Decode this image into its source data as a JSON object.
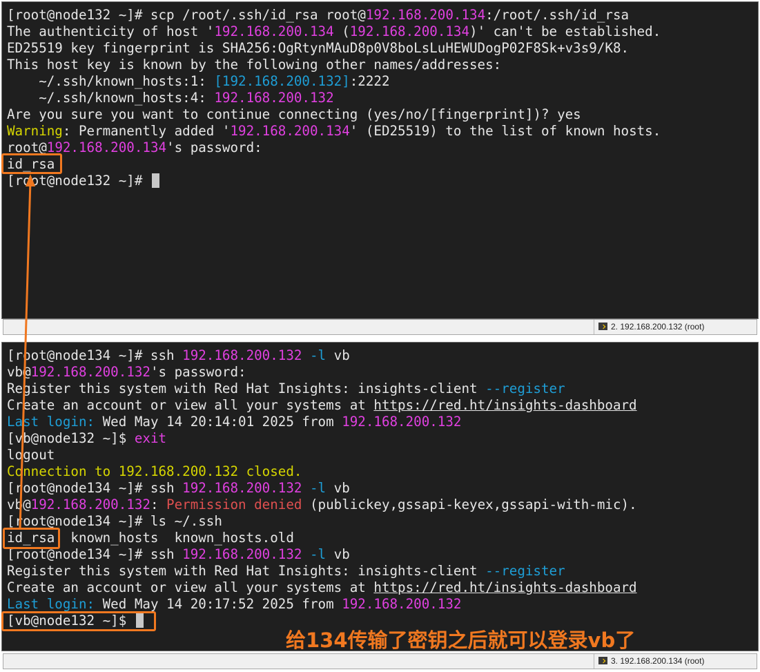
{
  "top_terminal": {
    "lines": [
      [
        {
          "t": "[root@node132 ~]# scp /root/.ssh/id_rsa root@"
        },
        {
          "t": "192.168.200.134",
          "k": "m"
        },
        {
          "t": ":/root/.ssh/id_rsa"
        }
      ],
      [
        {
          "t": "The authenticity of host '"
        },
        {
          "t": "192.168.200.134",
          "k": "m"
        },
        {
          "t": " ("
        },
        {
          "t": "192.168.200.134",
          "k": "m"
        },
        {
          "t": ")' can't be established."
        }
      ],
      [
        {
          "t": "ED25519 key fingerprint is SHA256:OgRtynMAuD8p0V8boLsLuHEWUDogP02F8Sk+v3s9/K8."
        }
      ],
      [
        {
          "t": "This host key is known by the following other names/addresses:"
        }
      ],
      [
        {
          "t": "    ~/.ssh/known_hosts:1: "
        },
        {
          "t": "[192.168.200.132]",
          "k": "c"
        },
        {
          "t": ":2222"
        }
      ],
      [
        {
          "t": "    ~/.ssh/known_hosts:4: "
        },
        {
          "t": "192.168.200.132",
          "k": "m"
        }
      ],
      [
        {
          "t": "Are you sure you want to continue connecting (yes/no/[fingerprint])? yes"
        }
      ],
      [
        {
          "t": "Warning",
          "k": "y"
        },
        {
          "t": ": Permanently added '"
        },
        {
          "t": "192.168.200.134",
          "k": "m"
        },
        {
          "t": "' (ED25519) to the list of known hosts."
        }
      ],
      [
        {
          "t": "root@"
        },
        {
          "t": "192.168.200.134",
          "k": "m"
        },
        {
          "t": "'s password:"
        }
      ],
      [
        {
          "t": "id_rsa"
        }
      ],
      [
        {
          "t": "[root@node132 ~]# "
        },
        {
          "cursor": true
        }
      ]
    ],
    "status_label": "2. 192.168.200.132 (root)"
  },
  "bottom_terminal": {
    "lines": [
      [
        {
          "t": "[root@node134 ~]# ssh "
        },
        {
          "t": "192.168.200.132",
          "k": "m"
        },
        {
          "t": " "
        },
        {
          "t": "-l",
          "k": "c"
        },
        {
          "t": " vb"
        }
      ],
      [
        {
          "t": "vb@"
        },
        {
          "t": "192.168.200.132",
          "k": "m"
        },
        {
          "t": "'s password:"
        }
      ],
      [
        {
          "t": "Register this system with Red Hat Insights: insights-client "
        },
        {
          "t": "--register",
          "k": "c"
        }
      ],
      [
        {
          "t": "Create an account or view all your systems at "
        },
        {
          "t": "https://red.ht/insights-dashboard",
          "k": "u"
        }
      ],
      [
        {
          "t": "Last login:",
          "k": "c"
        },
        {
          "t": " Wed May 14 20:14:01 2025 from "
        },
        {
          "t": "192.168.200.132",
          "k": "m"
        }
      ],
      [
        {
          "t": "[vb@node132 ~]$ "
        },
        {
          "t": "exit",
          "k": "m"
        }
      ],
      [
        {
          "t": "logout"
        }
      ],
      [
        {
          "t": "Connection to ",
          "k": "y"
        },
        {
          "t": "192.168.200.132",
          "k": "y"
        },
        {
          "t": " closed.",
          "k": "y"
        }
      ],
      [
        {
          "t": "[root@node134 ~]# ssh "
        },
        {
          "t": "192.168.200.132",
          "k": "m"
        },
        {
          "t": " "
        },
        {
          "t": "-l",
          "k": "c"
        },
        {
          "t": " vb"
        }
      ],
      [
        {
          "t": "vb@"
        },
        {
          "t": "192.168.200.132",
          "k": "m"
        },
        {
          "t": ": "
        },
        {
          "t": "Permission denied",
          "k": "r"
        },
        {
          "t": " (publickey,gssapi-keyex,gssapi-with-mic)."
        }
      ],
      [
        {
          "t": "[root@node134 ~]# ls ~/.ssh"
        }
      ],
      [
        {
          "t": "id_rsa  known_hosts  known_hosts.old"
        }
      ],
      [
        {
          "t": "[root@node134 ~]# ssh "
        },
        {
          "t": "192.168.200.132",
          "k": "m"
        },
        {
          "t": " "
        },
        {
          "t": "-l",
          "k": "c"
        },
        {
          "t": " vb"
        }
      ],
      [
        {
          "t": "Register this system with Red Hat Insights: insights-client "
        },
        {
          "t": "--register",
          "k": "c"
        }
      ],
      [
        {
          "t": "Create an account or view all your systems at "
        },
        {
          "t": "https://red.ht/insights-dashboard",
          "k": "u"
        }
      ],
      [
        {
          "t": "Last login:",
          "k": "c"
        },
        {
          "t": " Wed May 14 20:17:52 2025 from "
        },
        {
          "t": "192.168.200.132",
          "k": "m"
        }
      ],
      [
        {
          "t": "[vb@node132 ~]$ "
        },
        {
          "cursor": true
        }
      ]
    ],
    "status_label": "3. 192.168.200.134 (root)"
  },
  "annotation": {
    "caption": "给134传输了密钥之后就可以登录vb了",
    "color": "#f07820"
  },
  "icons": {
    "status_tab_icon": "terminal-session-icon"
  }
}
